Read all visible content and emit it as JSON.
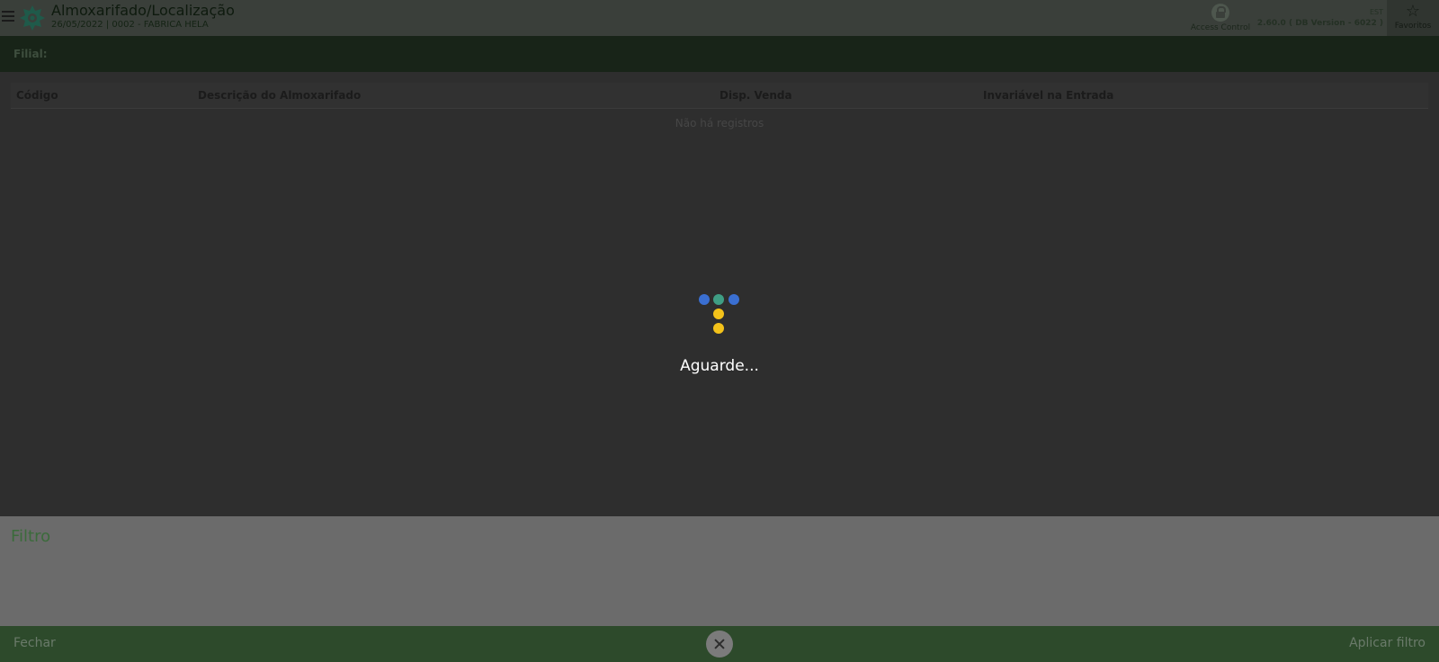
{
  "header": {
    "title": "Almoxarifado/Localização",
    "subtitle": "26/05/2022 | 0002 - FABRICA HELA",
    "access_control_label": "Access Control",
    "env_code": "EST",
    "version": "2.60.0 ( DB Version - 6022 )",
    "favorites_label": "Favoritos"
  },
  "filial": {
    "label": "Filial:"
  },
  "grid": {
    "columns": [
      "Código",
      "Descrição do Almoxarifado",
      "Disp. Venda",
      "Invariável na Entrada"
    ],
    "empty_message": "Não há registros"
  },
  "filter": {
    "title": "Filtro"
  },
  "footer": {
    "close_label": "Fechar",
    "apply_label": "Aplicar filtro"
  },
  "loading": {
    "text": "Aguarde...",
    "dot_colors": [
      "#3a6fd1",
      "#3f9e84",
      "#3a6fd1",
      "#f3c21a",
      "#f3c21a"
    ]
  }
}
